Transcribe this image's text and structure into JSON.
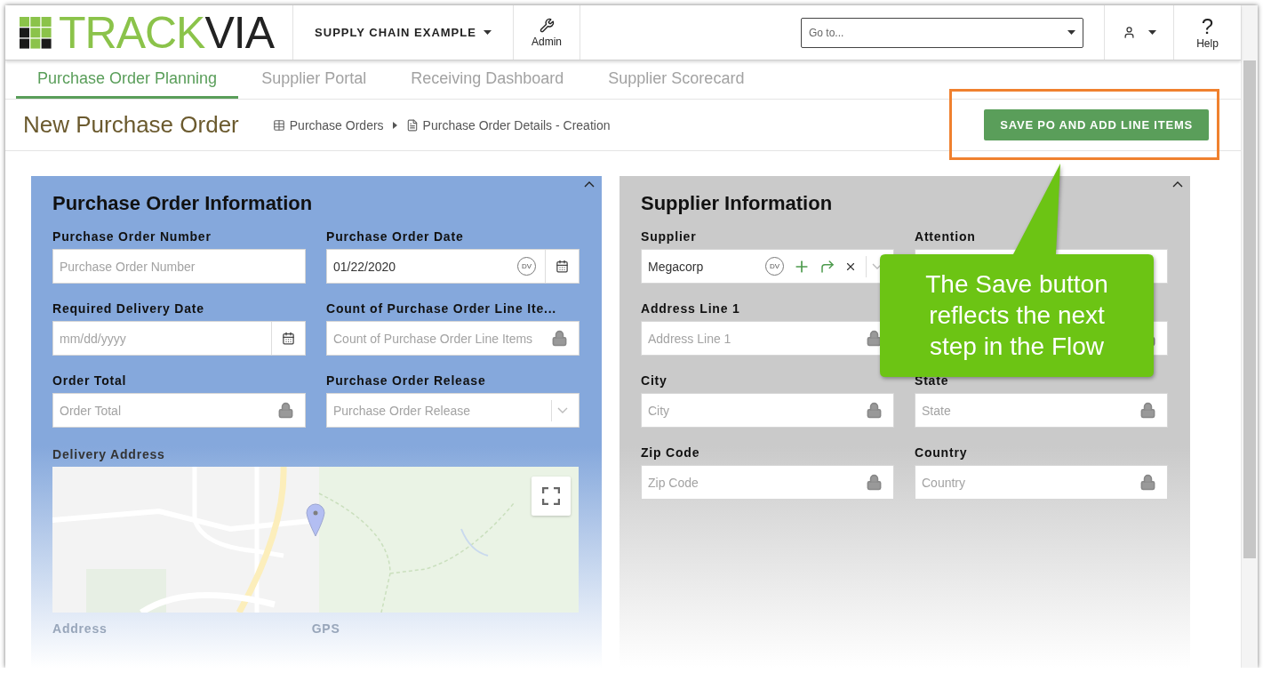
{
  "header": {
    "logo": {
      "part_1": "TRACK",
      "part_2": "VIA"
    },
    "app_menu": "SUPPLY CHAIN EXAMPLE",
    "admin": "Admin",
    "goto": {
      "placeholder": "Go to..."
    },
    "help_glyph": "?",
    "help": "Help"
  },
  "tabs": [
    {
      "label": "Purchase Order Planning",
      "selected": true
    },
    {
      "label": "Supplier Portal",
      "selected": false
    },
    {
      "label": "Receiving Dashboard",
      "selected": false
    },
    {
      "label": "Supplier Scorecard",
      "selected": false
    }
  ],
  "page": {
    "title": "New Purchase Order",
    "breadcrumbs": [
      {
        "label": "Purchase Orders",
        "kind": "table"
      },
      {
        "label": "Purchase Order Details - Creation",
        "kind": "form"
      }
    ],
    "save_button": "SAVE PO AND ADD LINE ITEMS"
  },
  "panels": [
    {
      "title": "Purchase Order Information",
      "color": "#85a8dc",
      "expanded": true,
      "fields": [
        {
          "label": "Purchase Order Number",
          "kind": "text",
          "placeholder": "Purchase Order Number"
        },
        {
          "label": "Purchase Order Date",
          "kind": "date",
          "value": "01/22/2020",
          "badge": "DV"
        },
        {
          "label": "Required Delivery Date",
          "kind": "datepicker",
          "placeholder": "mm/dd/yyyy"
        },
        {
          "label": "Count of Purchase Order Line Ite...",
          "kind": "locked",
          "placeholder": "Count of Purchase Order Line Items"
        },
        {
          "label": "Order Total",
          "kind": "locked",
          "placeholder": "Order Total"
        },
        {
          "label": "Purchase Order Release",
          "kind": "select",
          "placeholder": "Purchase Order Release"
        }
      ],
      "map": {
        "label": "Delivery Address",
        "kind": "picture"
      },
      "faded_labels": [
        "Address",
        "GPS"
      ]
    },
    {
      "title": "Supplier Information",
      "color": "#cacaca",
      "expanded": true,
      "fields": [
        {
          "label": "Supplier",
          "kind": "lookup",
          "value": "Megacorp",
          "badge": "DV"
        },
        {
          "label": "Attention",
          "kind": "text"
        },
        {
          "label": "Address Line 1",
          "kind": "locked",
          "placeholder": "Address Line 1"
        },
        {
          "kind": "locked"
        },
        {
          "label": "City",
          "kind": "locked",
          "placeholder": "City"
        },
        {
          "label": "State",
          "kind": "locked",
          "placeholder": "State"
        },
        {
          "label": "Zip Code",
          "kind": "locked",
          "placeholder": "Zip Code"
        },
        {
          "label": "Country",
          "kind": "locked",
          "placeholder": "Country"
        }
      ]
    }
  ],
  "callout": {
    "text": "The Save button reflects the next step in the Flow"
  }
}
